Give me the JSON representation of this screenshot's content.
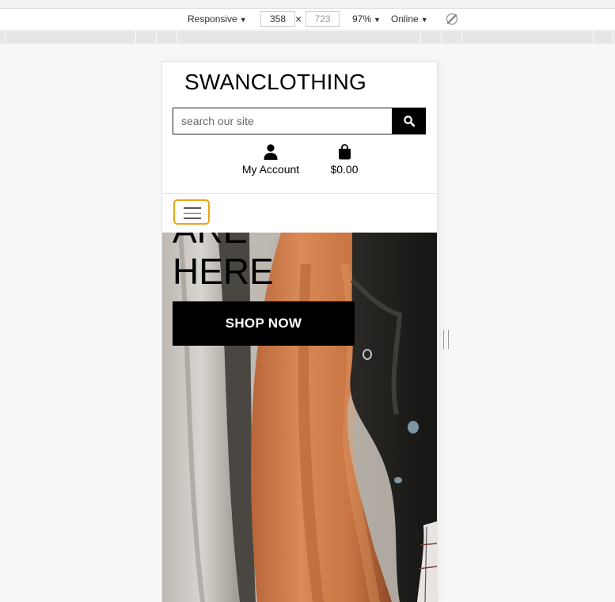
{
  "devtools": {
    "device_mode": "Responsive",
    "width": "358",
    "height_placeholder": "723",
    "times_symbol": "×",
    "zoom": "97%",
    "network": "Online",
    "caret": "▼",
    "rotate_icon": "rotate-icon"
  },
  "site": {
    "brand": "SWANCLOTHING",
    "search": {
      "placeholder": "search our site",
      "button_icon": "search-icon"
    },
    "account": {
      "label": "My Account",
      "icon": "user-icon"
    },
    "cart": {
      "label": "$0.00",
      "icon": "shopping-bag-icon"
    },
    "menu_toggle_icon": "hamburger-icon",
    "accent_color": "#e8a617",
    "hero": {
      "headline": "ARE\nHERE",
      "cta_label": "SHOP NOW"
    }
  }
}
